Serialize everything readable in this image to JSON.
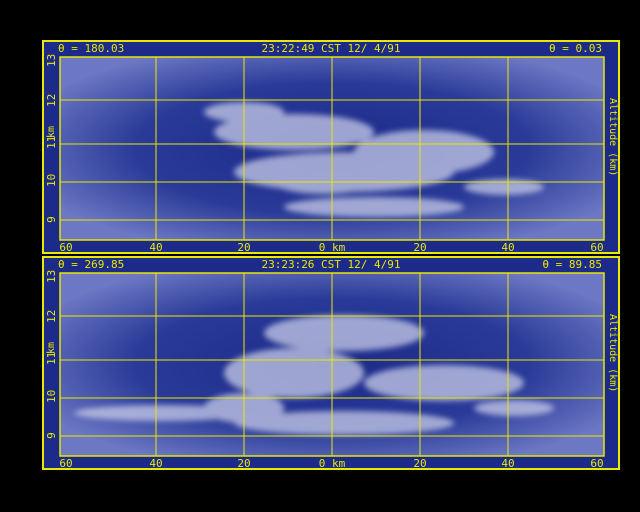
{
  "panels": [
    {
      "theta_left": "θ = 180.03",
      "timestamp": "23:22:49 CST 12/ 4/91",
      "theta_right": "θ = 0.03",
      "x_ticks": [
        "60",
        "40",
        "20",
        "0 km",
        "20",
        "40",
        "60"
      ],
      "y_ticks": [
        "13",
        "12",
        "11",
        "10",
        "9"
      ],
      "y_label_left": "km",
      "y_label_right": "Altitude (km)"
    },
    {
      "theta_left": "θ = 269.85",
      "timestamp": "23:23:26 CST 12/ 4/91",
      "theta_right": "θ = 89.85",
      "x_ticks": [
        "60",
        "40",
        "20",
        "0 km",
        "20",
        "40",
        "60"
      ],
      "y_ticks": [
        "13",
        "12",
        "11",
        "10",
        "9"
      ],
      "y_label_left": "km",
      "y_label_right": "Altitude (km)"
    }
  ],
  "colors": {
    "frame": "#e8e800",
    "background": "#1c2a8a",
    "cloud": "#c8cce8"
  }
}
